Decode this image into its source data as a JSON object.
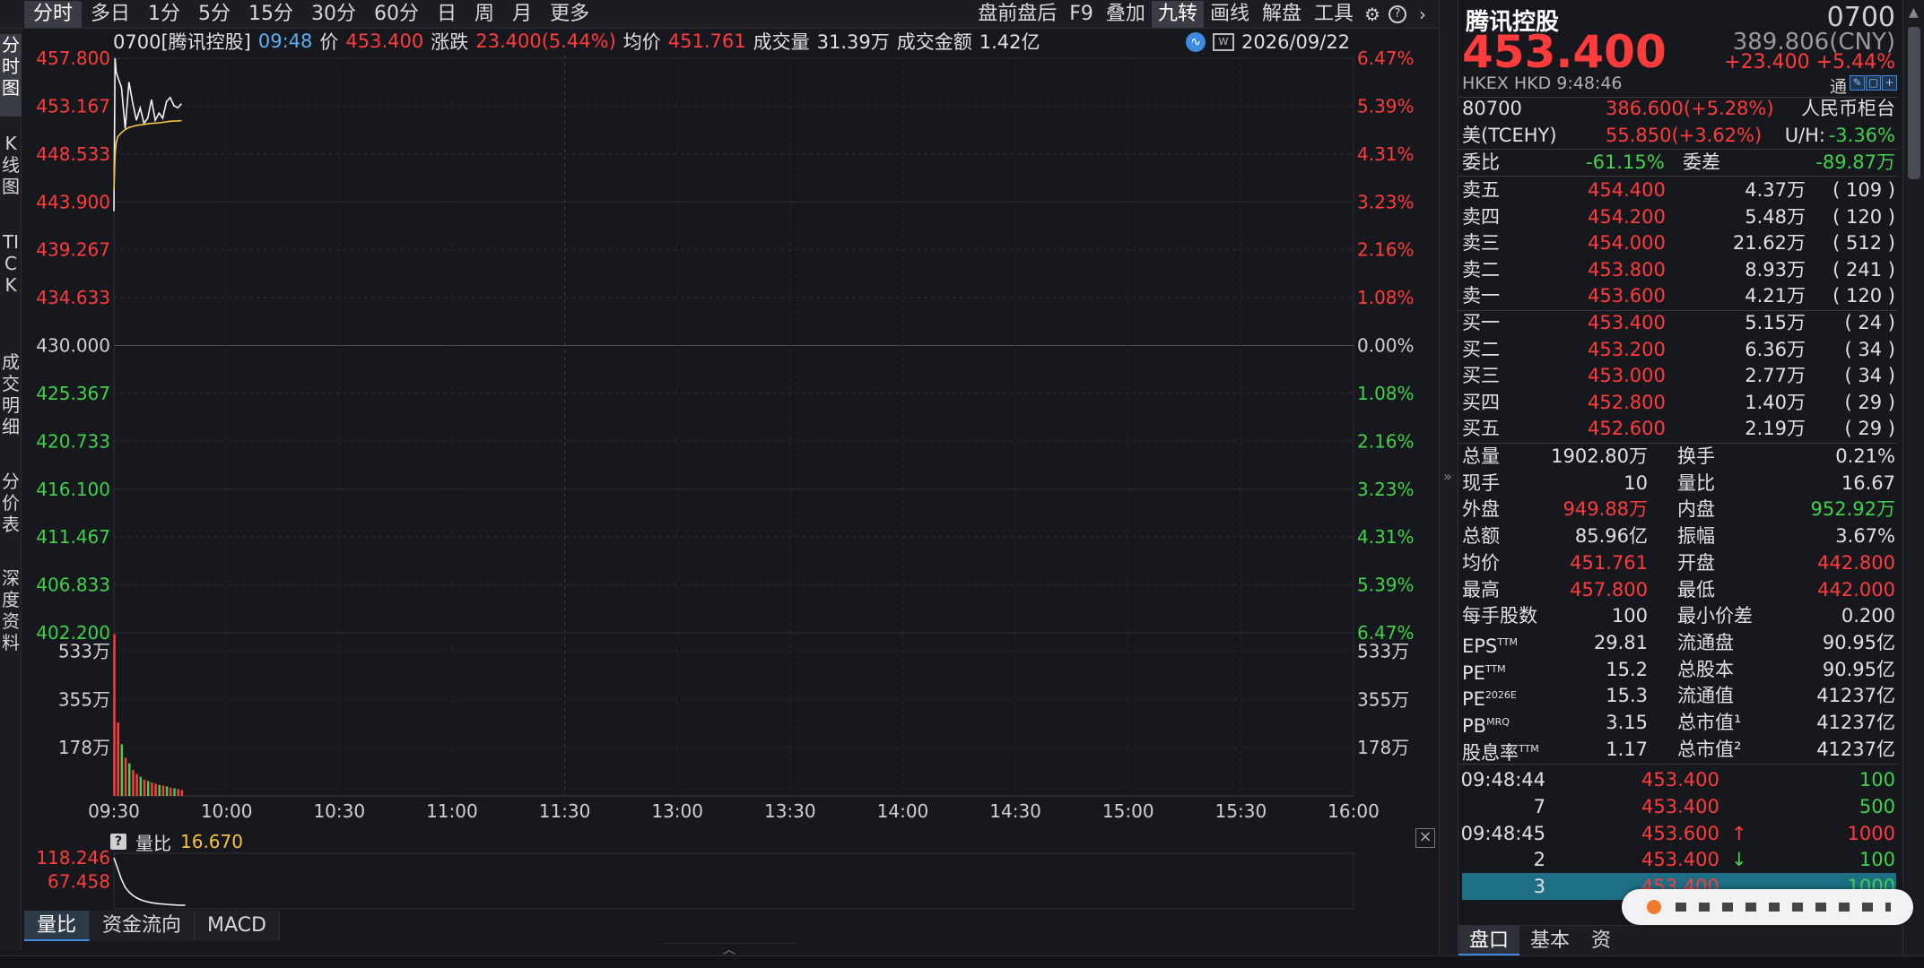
{
  "toolbar": {
    "period_tabs": [
      "分时",
      "多日",
      "1分",
      "5分",
      "15分",
      "30分",
      "60分",
      "日",
      "周",
      "月",
      "更多"
    ],
    "active_period": "分时",
    "right_tools": [
      "盘前盘后",
      "F9",
      "叠加",
      "九转",
      "画线",
      "解盘",
      "工具"
    ],
    "active_tool": "九转",
    "icons": [
      "gear-icon",
      "help-icon",
      "chevron-right-icon"
    ]
  },
  "left_tabs": [
    {
      "label": "分时图",
      "active": true
    },
    {
      "label": "K线图",
      "active": false
    },
    {
      "label": "TICK",
      "active": false
    },
    {
      "label": "成交明细",
      "active": false
    },
    {
      "label": "分价表",
      "active": false
    },
    {
      "label": "深度资料",
      "active": false
    }
  ],
  "info_line": {
    "code_name": "0700[腾讯控股]",
    "time": "09:48",
    "price_label": "价",
    "price": "453.400",
    "change_label": "涨跌",
    "change": "23.400(5.44%)",
    "avg_label": "均价",
    "avg": "451.761",
    "volume_label": "成交量",
    "volume": "31.39万",
    "amount_label": "成交金额",
    "amount": "1.42亿",
    "date": "2026/09/22",
    "icons": [
      "pulse-icon",
      "presentation-icon"
    ]
  },
  "chart_data": {
    "type": "line",
    "title": "",
    "prev_close": 430.0,
    "price_axis": [
      "457.800",
      "453.167",
      "448.533",
      "443.900",
      "439.267",
      "434.633",
      "430.000",
      "425.367",
      "420.733",
      "416.100",
      "411.467",
      "406.833",
      "402.200"
    ],
    "pct_axis": [
      "6.47%",
      "5.39%",
      "4.31%",
      "3.23%",
      "2.16%",
      "1.08%",
      "0.00%",
      "1.08%",
      "2.16%",
      "3.23%",
      "4.31%",
      "5.39%",
      "6.47%"
    ],
    "ylim": [
      402.2,
      457.8
    ],
    "x_ticks": [
      "09:30",
      "10:00",
      "10:30",
      "11:00",
      "11:30",
      "13:00",
      "13:30",
      "14:00",
      "14:30",
      "15:00",
      "15:30",
      "16:00"
    ],
    "series": [
      {
        "name": "价",
        "color": "#f2f2f2",
        "minutes": [
          0,
          0.3,
          0.6,
          1,
          2,
          3,
          4,
          5,
          6,
          7,
          8,
          9,
          10,
          11,
          12,
          13,
          14,
          15,
          16,
          17,
          18
        ],
        "values": [
          443.0,
          457.8,
          456.5,
          456.0,
          455.0,
          451.0,
          455.5,
          453.5,
          451.8,
          453.0,
          451.5,
          452.0,
          453.8,
          451.8,
          452.5,
          452.0,
          453.6,
          454.0,
          453.2,
          453.0,
          453.4
        ]
      },
      {
        "name": "均价",
        "color": "#f5c242",
        "minutes": [
          0,
          0.3,
          0.6,
          1,
          2,
          3,
          4,
          5,
          6,
          7,
          8,
          9,
          10,
          11,
          12,
          13,
          14,
          15,
          16,
          17,
          18
        ],
        "values": [
          445.0,
          448.5,
          449.6,
          450.2,
          450.6,
          450.9,
          451.1,
          451.2,
          451.3,
          451.35,
          451.4,
          451.45,
          451.5,
          451.52,
          451.55,
          451.6,
          451.65,
          451.7,
          451.72,
          451.74,
          451.761
        ]
      }
    ],
    "volume_axis": [
      "533万",
      "355万",
      "178万"
    ],
    "volume_max_wan": 600,
    "volumes_wan": [
      595,
      270,
      190,
      140,
      120,
      95,
      80,
      70,
      60,
      55,
      50,
      45,
      40,
      38,
      35,
      30,
      28,
      25,
      22
    ],
    "volume_colors": [
      "r",
      "r",
      "g",
      "r",
      "g",
      "r",
      "r",
      "g",
      "r",
      "g",
      "r",
      "r",
      "g",
      "r",
      "g",
      "r",
      "g",
      "r",
      "r"
    ]
  },
  "sub_chart": {
    "help": "?",
    "label": "量比",
    "value": "16.670",
    "axis": [
      "118.246",
      "67.458"
    ],
    "ylim": [
      16.67,
      118.246
    ],
    "values": [
      118.246,
      95,
      72,
      55,
      45,
      38,
      33,
      29,
      26,
      24,
      22,
      21,
      20,
      19.3,
      18.6,
      18,
      17.5,
      17.1,
      16.8,
      16.67
    ]
  },
  "indicator_tabs": [
    "量比",
    "资金流向",
    "MACD"
  ],
  "active_indicator": "量比",
  "quote": {
    "name": "腾讯控股",
    "code": "0700",
    "price": "453.400",
    "cny": "389.806(CNY)",
    "change": "+23.400",
    "change_pct": "+5.44%",
    "exchange": "HKEX",
    "currency": "HKD",
    "time": "9:48:46",
    "tong": "通"
  },
  "rmb_counter": {
    "code": "80700",
    "value": "386.600(+5.28%)",
    "label": "人民币柜台"
  },
  "us_adr": {
    "code": "美(TCEHY)",
    "value": "55.850(+3.62%)",
    "uh_label": "U/H:",
    "uh": "-3.36%"
  },
  "ratio": {
    "wb_label": "委比",
    "wb": "-61.15%",
    "wc_label": "委差",
    "wc": "-89.87万"
  },
  "asks": [
    {
      "label": "卖五",
      "price": "454.400",
      "vol": "4.37万",
      "orders": "( 109 )"
    },
    {
      "label": "卖四",
      "price": "454.200",
      "vol": "5.48万",
      "orders": "( 120 )"
    },
    {
      "label": "卖三",
      "price": "454.000",
      "vol": "21.62万",
      "orders": "( 512 )"
    },
    {
      "label": "卖二",
      "price": "453.800",
      "vol": "8.93万",
      "orders": "( 241 )"
    },
    {
      "label": "卖一",
      "price": "453.600",
      "vol": "4.21万",
      "orders": "( 120 )"
    }
  ],
  "bids": [
    {
      "label": "买一",
      "price": "453.400",
      "vol": "5.15万",
      "orders": "( 24 )"
    },
    {
      "label": "买二",
      "price": "453.200",
      "vol": "6.36万",
      "orders": "( 34 )"
    },
    {
      "label": "买三",
      "price": "453.000",
      "vol": "2.77万",
      "orders": "( 34 )"
    },
    {
      "label": "买四",
      "price": "452.800",
      "vol": "1.40万",
      "orders": "( 29 )"
    },
    {
      "label": "买五",
      "price": "452.600",
      "vol": "2.19万",
      "orders": "( 29 )"
    }
  ],
  "stats": [
    {
      "l1": "总量",
      "v1": "1902.80万",
      "c1": "w",
      "l2": "换手",
      "v2": "0.21%",
      "c2": "w"
    },
    {
      "l1": "现手",
      "v1": "10",
      "c1": "w",
      "l2": "量比",
      "v2": "16.67",
      "c2": "w"
    },
    {
      "l1": "外盘",
      "v1": "949.88万",
      "c1": "r",
      "l2": "内盘",
      "v2": "952.92万",
      "c2": "g"
    },
    {
      "l1": "总额",
      "v1": "85.96亿",
      "c1": "w",
      "l2": "振幅",
      "v2": "3.67%",
      "c2": "w"
    },
    {
      "l1": "均价",
      "v1": "451.761",
      "c1": "r",
      "l2": "开盘",
      "v2": "442.800",
      "c2": "r"
    },
    {
      "l1": "最高",
      "v1": "457.800",
      "c1": "r",
      "l2": "最低",
      "v2": "442.000",
      "c2": "r"
    },
    {
      "l1": "每手股数",
      "v1": "100",
      "c1": "w",
      "l2": "最小价差",
      "v2": "0.200",
      "c2": "w"
    },
    {
      "l1": "EPS",
      "s1": "TTM",
      "v1": "29.81",
      "c1": "w",
      "l2": "流通盘",
      "v2": "90.95亿",
      "c2": "w"
    },
    {
      "l1": "PE",
      "s1": "TTM",
      "v1": "15.2",
      "c1": "w",
      "l2": "总股本",
      "v2": "90.95亿",
      "c2": "w"
    },
    {
      "l1": "PE",
      "s1": "2026E",
      "v1": "15.3",
      "c1": "w",
      "l2": "流通值",
      "v2": "41237亿",
      "c2": "w"
    },
    {
      "l1": "PB",
      "s1": "MRQ",
      "v1": "3.15",
      "c1": "w",
      "l2": "总市值¹",
      "v2": "41237亿",
      "c2": "w"
    },
    {
      "l1": "股息率",
      "s1": "TTM",
      "v1": "1.17",
      "c1": "w",
      "l2": "总市值²",
      "v2": "41237亿",
      "c2": "w"
    }
  ],
  "ticks": [
    {
      "time": "09:48:44",
      "price": "453.400",
      "vol": "100",
      "arrow": ""
    },
    {
      "time": "7",
      "price": "453.400",
      "vol": "500",
      "arrow": ""
    },
    {
      "time": "09:48:45",
      "price": "453.600",
      "vol": "1000",
      "arrow": "↑"
    },
    {
      "time": "2",
      "price": "453.400",
      "vol": "100",
      "arrow": "↓"
    },
    {
      "time": "3",
      "price": "453.400",
      "vol": "1000",
      "arrow": ""
    }
  ],
  "right_tabs": [
    "盘口",
    "基本",
    "资"
  ],
  "active_right_tab": "盘口"
}
